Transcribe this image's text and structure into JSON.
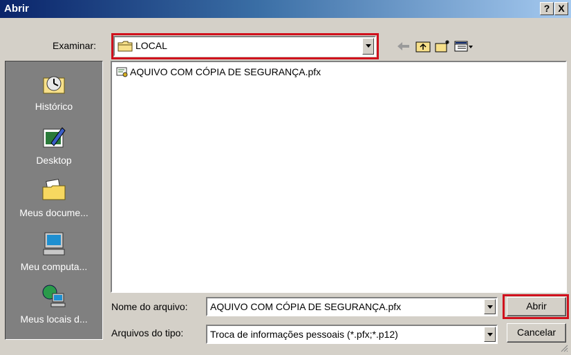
{
  "window": {
    "title": "Abrir",
    "help_label": "?",
    "close_label": "X"
  },
  "toolbar": {
    "look_in_label": "Examinar:",
    "look_in_value": "LOCAL",
    "icons": [
      "back-icon",
      "up-folder-icon",
      "new-folder-icon",
      "view-menu-icon"
    ]
  },
  "places": [
    {
      "label": "Histórico",
      "icon": "history-icon"
    },
    {
      "label": "Desktop",
      "icon": "desktop-icon"
    },
    {
      "label": "Meus docume...",
      "icon": "my-documents-icon"
    },
    {
      "label": "Meu computa...",
      "icon": "my-computer-icon"
    },
    {
      "label": "Meus locais d...",
      "icon": "network-places-icon"
    }
  ],
  "files": [
    {
      "name": "AQUIVO COM CÓPIA DE SEGURANÇA.pfx",
      "icon": "certificate-file-icon"
    }
  ],
  "form": {
    "filename_label": "Nome do arquivo:",
    "filename_value": "AQUIVO COM CÓPIA DE SEGURANÇA.pfx",
    "filetype_label": "Arquivos do tipo:",
    "filetype_value": "Troca de informações pessoais (*.pfx;*.p12)"
  },
  "buttons": {
    "open_label": "Abrir",
    "cancel_label": "Cancelar"
  },
  "colors": {
    "highlight": "#d0101c",
    "title_bar": "#0a246a",
    "dialog_bg": "#d4d0c8"
  }
}
